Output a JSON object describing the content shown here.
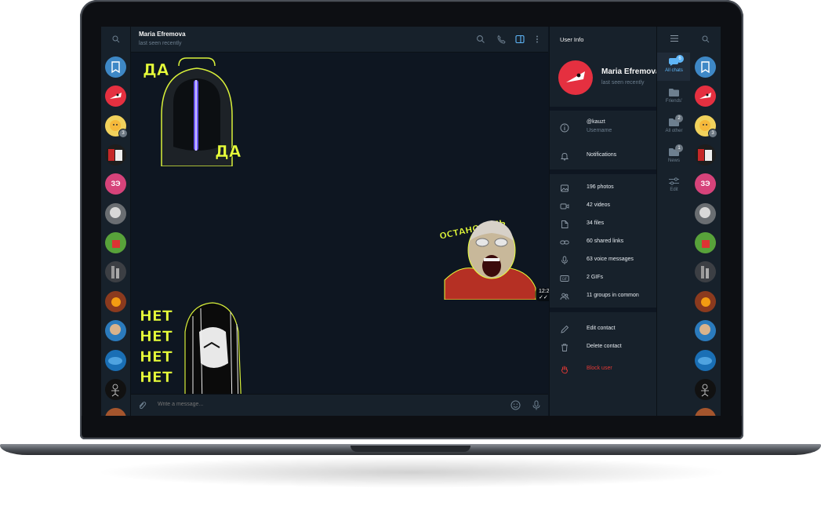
{
  "colors": {
    "accent": "#5eb5f7",
    "danger": "#e53935",
    "chat_bg": "#0e1621",
    "panel_bg": "#17212b",
    "muted_text": "#6d7f8f"
  },
  "chat": {
    "name": "Maria Efremova",
    "status": "last seen recently"
  },
  "stickers": {
    "da_top": "ДА",
    "da_bottom": "ДА",
    "ostanovis": "ОСТАНОВИСЬ",
    "net_lines": [
      "НЕТ",
      "НЕТ",
      "НЕТ",
      "НЕТ"
    ],
    "ostanovis_time": "12:22"
  },
  "composer": {
    "placeholder": "Write a message..."
  },
  "user_info": {
    "title": "User Info",
    "name": "Maria Efremova",
    "status": "last seen recently",
    "username": "@kauzt",
    "username_label": "Username",
    "notifications": "Notifications",
    "media": [
      {
        "icon": "photo-icon",
        "label": "196 photos"
      },
      {
        "icon": "video-icon",
        "label": "42 videos"
      },
      {
        "icon": "file-icon",
        "label": "34 files"
      },
      {
        "icon": "link-icon",
        "label": "60 shared links"
      },
      {
        "icon": "microphone-icon",
        "label": "63 voice messages"
      },
      {
        "icon": "gif-icon",
        "label": "2 GIFs"
      },
      {
        "icon": "groups-icon",
        "label": "11 groups in common"
      }
    ],
    "edit_contact": "Edit contact",
    "delete_contact": "Delete contact",
    "block_user": "Block user"
  },
  "folders": [
    {
      "label": "All chats",
      "badge": "6",
      "icon": "chat-bubbles-icon",
      "active": true
    },
    {
      "label": "Friends'",
      "badge": "",
      "icon": "folder-icon",
      "active": false
    },
    {
      "label": "All other",
      "badge": "2",
      "icon": "folder-icon",
      "active": false
    },
    {
      "label": "News",
      "badge": "1",
      "icon": "folder-icon",
      "active": false
    },
    {
      "label": "Edit",
      "badge": "",
      "icon": "sliders-icon",
      "active": false
    }
  ],
  "chat_list": {
    "badges": {
      "sun_avatar": "3"
    },
    "initials_avatar": "ЗЭ"
  }
}
